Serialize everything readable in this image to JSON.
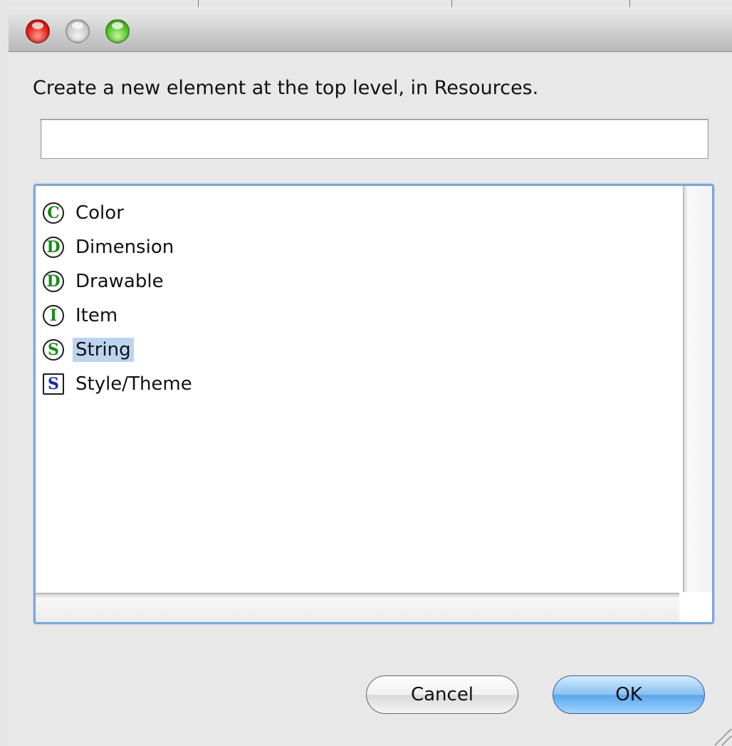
{
  "dialog": {
    "prompt": "Create a new element at the top level, in Resources.",
    "name_input": {
      "value": "",
      "placeholder": ""
    }
  },
  "element_list": {
    "items": [
      {
        "label": "Color",
        "icon_letter": "C",
        "icon": "green-circle-c-icon",
        "selected": false
      },
      {
        "label": "Dimension",
        "icon_letter": "D",
        "icon": "green-circle-d-icon",
        "selected": false
      },
      {
        "label": "Drawable",
        "icon_letter": "D",
        "icon": "green-circle-d-icon",
        "selected": false
      },
      {
        "label": "Item",
        "icon_letter": "I",
        "icon": "green-circle-i-icon",
        "selected": false
      },
      {
        "label": "String",
        "icon_letter": "S",
        "icon": "green-circle-s-icon",
        "selected": true
      },
      {
        "label": "Style/Theme",
        "icon_letter": "S",
        "icon": "blue-square-s-icon",
        "selected": false
      }
    ]
  },
  "buttons": {
    "cancel": "Cancel",
    "ok": "OK"
  },
  "colors": {
    "selection": "#bcd4ef",
    "focus_ring": "#7aa6d8",
    "icon_green": "#168c16",
    "icon_blue": "#1a2d9a",
    "default_button": "#5aa7ec"
  }
}
